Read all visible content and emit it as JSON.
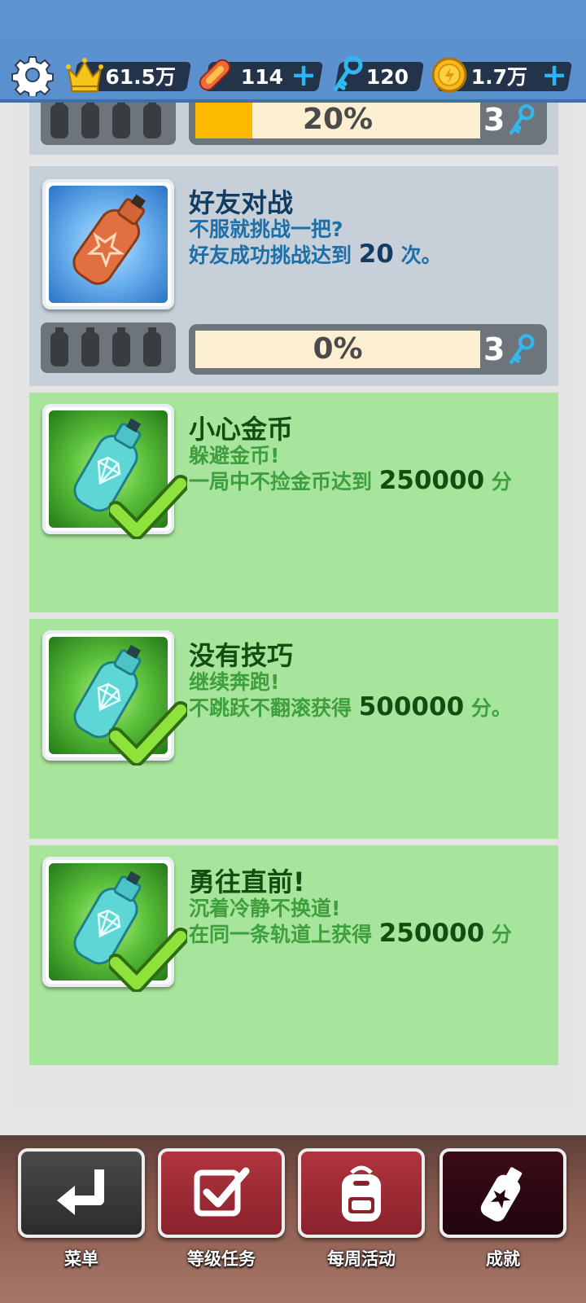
{
  "topbar": {
    "crown_value": "61.5万",
    "hoverboard_value": "114",
    "key_value": "120",
    "coin_value": "1.7万"
  },
  "achievements": [
    {
      "status": "locked",
      "progress_label": "20%",
      "progress": 0.2,
      "reward": "3"
    },
    {
      "status": "locked",
      "title": "好友对战",
      "line1": "不服就挑战一把?",
      "line2_pre": "好友成功挑战达到 ",
      "line2_num": "20",
      "line2_post": " 次。",
      "progress_label": "0%",
      "progress": 0,
      "reward": "3"
    },
    {
      "status": "done",
      "title": "小心金币",
      "line1": "躲避金币!",
      "line2_pre": " 一局中不捡金币达到 ",
      "line2_num": "250000",
      "line2_post": " 分"
    },
    {
      "status": "done",
      "title": "没有技巧",
      "line1": "继续奔跑!",
      "line2_pre": "不跳跃不翻滚获得 ",
      "line2_num": "500000",
      "line2_post": " 分。"
    },
    {
      "status": "done",
      "title": "勇往直前!",
      "line1": "沉着冷静不换道!",
      "line2_pre": "在同一条轨道上获得 ",
      "line2_num": "250000",
      "line2_post": " 分"
    }
  ],
  "nav": {
    "menu": "菜单",
    "level_tasks": "等级任务",
    "weekly": "每周活动",
    "achievements": "成就"
  },
  "colors": {
    "topbar": "#5e93d1",
    "locked_card": "#c7d0d9",
    "done_card": "#a8e59c",
    "progress_fill": "#fbb900",
    "title_dark_blue": "#123c62",
    "title_dark_green": "#114f11"
  },
  "icons": [
    "gear-icon",
    "crown-icon",
    "hoverboard-icon",
    "key-icon",
    "coin-icon",
    "plus-icon",
    "spray-can-icon",
    "check-icon",
    "return-icon",
    "checkbox-icon",
    "backpack-icon"
  ]
}
